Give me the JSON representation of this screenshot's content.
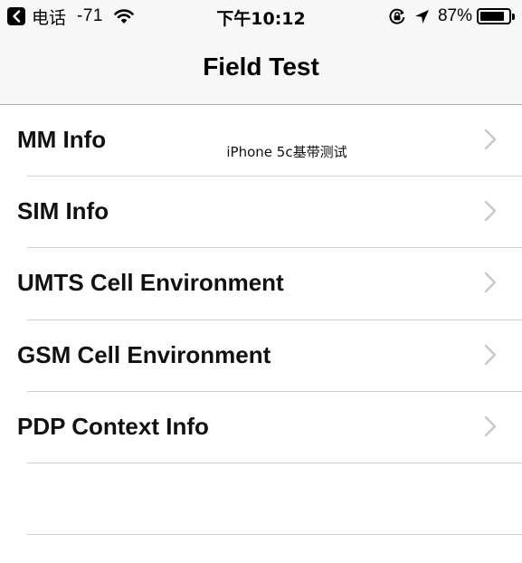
{
  "status_bar": {
    "back_app": "电话",
    "signal": "-71",
    "time": "下午10:12",
    "battery_percent": "87%",
    "battery_level": 0.87,
    "icons": [
      "back-arrow-icon",
      "wifi-icon",
      "orientation-lock-icon",
      "location-arrow-icon",
      "battery-icon"
    ]
  },
  "nav": {
    "title": "Field Test"
  },
  "list": {
    "items": [
      {
        "label": "MM Info"
      },
      {
        "label": "SIM Info"
      },
      {
        "label": "UMTS Cell Environment"
      },
      {
        "label": "GSM Cell Environment"
      },
      {
        "label": "PDP Context Info"
      }
    ]
  },
  "watermark": "iPhone 5c基带测试",
  "colors": {
    "bar_background": "#f7f7f7",
    "separator": "#cfcfd4",
    "chevron": "#c7c7cc",
    "text": "#000000"
  }
}
